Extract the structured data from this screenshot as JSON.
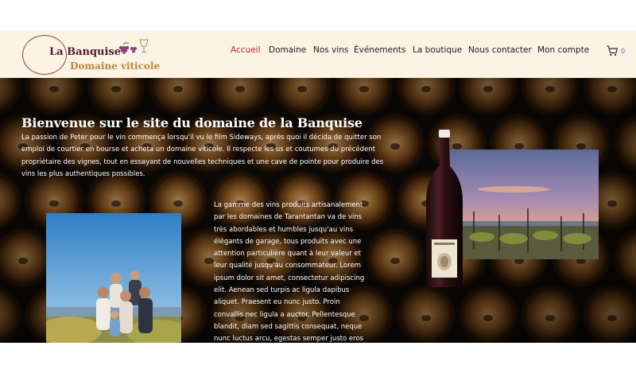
{
  "brand": {
    "line1": "La Banquise",
    "line2": "Domaine viticole"
  },
  "nav": {
    "items": [
      {
        "label": "Accueil",
        "active": true
      },
      {
        "label": "Domaine",
        "active": false
      },
      {
        "label": "Nos vins",
        "active": false
      },
      {
        "label": "Événements",
        "active": false
      },
      {
        "label": "La boutique",
        "active": false
      },
      {
        "label": "Nous contacter",
        "active": false
      },
      {
        "label": "Mon compte",
        "active": false
      }
    ]
  },
  "cart": {
    "count": "0",
    "icon": "shopping-cart-icon"
  },
  "hero": {
    "title": "Bienvenue sur le site du domaine de la Banquise",
    "intro": "La passion de Peter pour le vin commença lorsqu'il vu le film Sideways, après quoi il décida de quitter son emploi de courtier en bourse et acheta un domaine viticole.  Il respecte les us et coutumes du précédent propriétaire des vignes, tout en essayant de nouvelles techniques et une cave de pointe pour produire des vins les plus authentiques possibles.",
    "body": "La gamme des vins produits artisanalement par les domaines de Tarantantan va de vins très abordables et humbles jusqu'au vins élégants de garage, tous produits avec une attention particulière quant à leur valeur et leur qualité jusqu'au consommateur. Lorem ipsum dolor sit amet, consectetur adipiscing elit. Aenean sed turpis ac ligula dapibus aliquet. Praesent eu nunc justo. Proin convallis nec ligula a auctor. Pellentesque blandit, diam sed sagittis consequat, neque nunc luctus arcu, egestas semper justo eros at"
  },
  "colors": {
    "header_bg": "#fbf3e4",
    "nav_active": "#c3243f",
    "brand_dark": "#5a1a2c",
    "brand_gold": "#b7883c",
    "hero_bg": "#0e0b07"
  }
}
